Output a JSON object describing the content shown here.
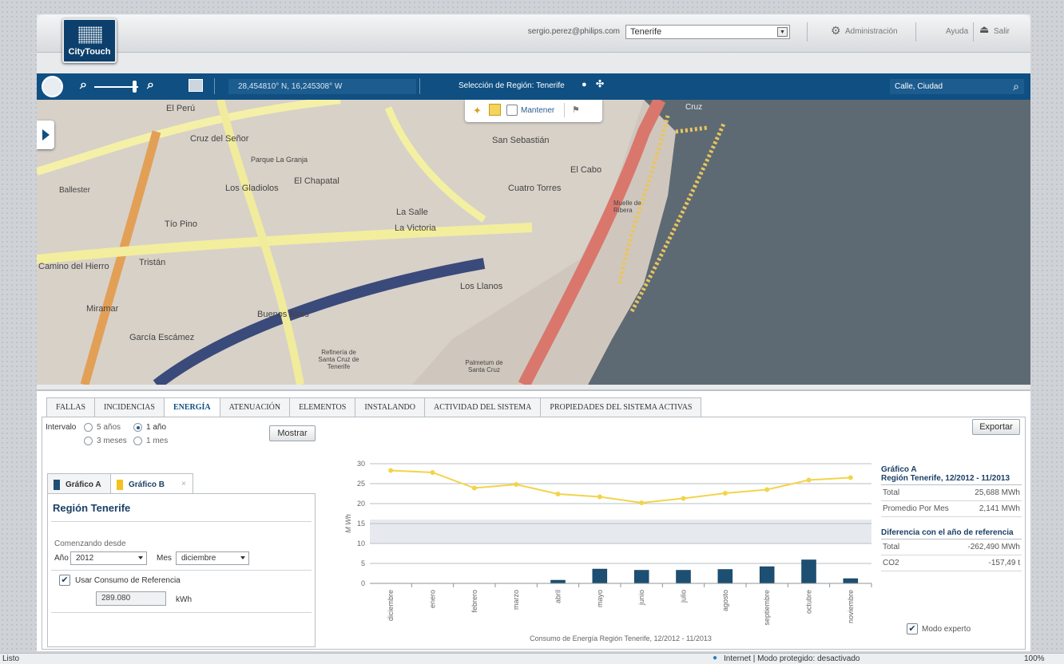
{
  "header": {
    "logo_text": "CityTouch",
    "user_email": "sergio.perez@philips.com",
    "region_select_value": "Tenerife",
    "admin_label": "Administración",
    "help_label": "Ayuda",
    "logout_label": "Salir"
  },
  "map_toolbar": {
    "coordinates": "28,454810° N,  16,245308° W",
    "region_selection": "Selección de Región:  Tenerife",
    "address_search_placeholder": "Calle, Ciudad"
  },
  "map": {
    "tools": {
      "keep_label": "Mantener"
    },
    "labels": [
      "El Perú",
      "Cruz del Señor",
      "Parque La Granja",
      "Los Gladiolos",
      "El Chapatal",
      "San Sebastián",
      "Cuatro Torres",
      "El Cabo",
      "Tío Pino",
      "La Salle",
      "La Victoria",
      "Los Llanos",
      "Muelle de Ribera",
      "Camino del Hierro",
      "Tristán",
      "Miramar",
      "García Escámez",
      "Buenos Aires",
      "Refinería de Santa Cruz de Tenerife",
      "Palmetum de Santa Cruz",
      "Ballester",
      "Cruz"
    ]
  },
  "tabs": [
    "FALLAS",
    "INCIDENCIAS",
    "ENERGÍA",
    "ATENUACIÓN",
    "ELEMENTOS",
    "INSTALANDO",
    "ACTIVIDAD DEL SISTEMA",
    "PROPIEDADES DEL SISTEMA ACTIVAS"
  ],
  "active_tab": "ENERGÍA",
  "interval": {
    "label": "Intervalo",
    "options": [
      "5 años",
      "1 año",
      "3 meses",
      "1 mes"
    ],
    "selected": "1 año",
    "show_button": "Mostrar"
  },
  "graph_tabs": {
    "a": "Gráfico A",
    "b": "Gráfico B",
    "close": "×"
  },
  "graph_form": {
    "region_title": "Región  Tenerife",
    "starting_label": "Comenzando desde",
    "year_label": "Año",
    "year_value": "2012",
    "month_label": "Mes",
    "month_value": "diciembre",
    "use_reference_label": "Usar Consumo de Referencia",
    "reference_value": "289.080",
    "reference_unit": "kWh"
  },
  "export_button": "Exportar",
  "expert_mode_label": "Modo experto",
  "summary": {
    "graph_label": "Gráfico A",
    "region_period": "Región  Tenerife, 12/2012 - 11/2013",
    "rows": [
      {
        "label": "Total",
        "value": "25,688 MWh"
      },
      {
        "label": "Promedio Por Mes",
        "value": "2,141 MWh"
      }
    ],
    "diff_title": "Diferencia con el año de referencia",
    "diff_rows": [
      {
        "label": "Total",
        "value": "-262,490 MWh"
      },
      {
        "label": "CO2",
        "value": "-157,49 t"
      }
    ]
  },
  "chart_data": {
    "type": "bar",
    "title": "Consumo de Energía Región  Tenerife, 12/2012 - 11/2013",
    "ylabel": "M Wh",
    "ylim": [
      0,
      30
    ],
    "yticks": [
      0,
      5,
      10,
      15,
      20,
      25,
      30
    ],
    "categories": [
      "diciembre",
      "enero",
      "febrero",
      "marzo",
      "abril",
      "mayo",
      "junio",
      "julio",
      "agosto",
      "septiembre",
      "octubre",
      "noviembre"
    ],
    "series": [
      {
        "type": "bar",
        "values": [
          0,
          0,
          0,
          0,
          0.8,
          3.6,
          3.3,
          3.3,
          3.5,
          4.2,
          5.9,
          1.2
        ],
        "color": "#1d4f73"
      },
      {
        "type": "line",
        "values": [
          28.3,
          27.8,
          23.9,
          24.8,
          22.4,
          21.7,
          20.2,
          21.3,
          22.6,
          23.5,
          25.9,
          26.5
        ],
        "color": "#f2d44a"
      }
    ],
    "reference_band": [
      10,
      16
    ],
    "grid": true
  },
  "status_bar": {
    "left": "Listo",
    "zone": "Internet | Modo protegido: desactivado",
    "zoom": "100%"
  }
}
